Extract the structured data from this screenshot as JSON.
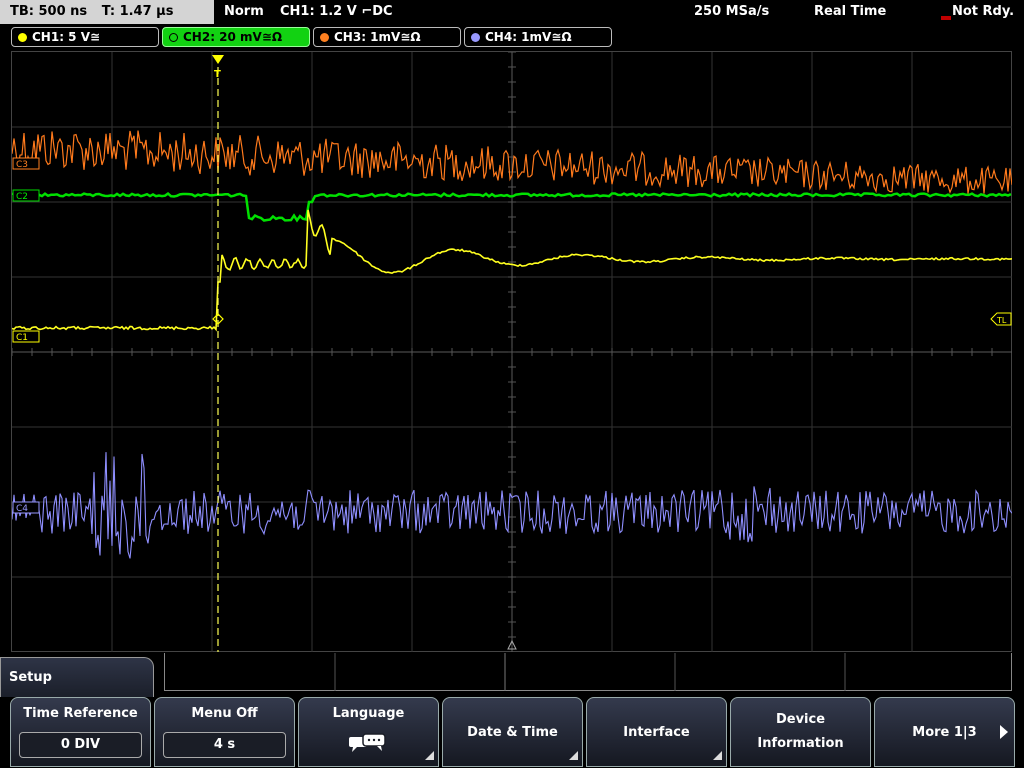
{
  "status": {
    "timebase": "TB: 500 ns",
    "trigger_time": "T: 1.47 µs",
    "mode": "Norm",
    "trigger_source": "CH1: 1.2 V ⌐DC",
    "sample_rate": "250 MSa/s",
    "acquisition": "Real Time",
    "state": "Not Rdy."
  },
  "channels": [
    {
      "label": "CH1: 5 V≅",
      "color": "#ffff00"
    },
    {
      "label": "CH2: 20 mV≅Ω",
      "color": "#00ff00"
    },
    {
      "label": "CH3: 1mV≅Ω",
      "color": "#ff8020"
    },
    {
      "label": "CH4: 1mV≅Ω",
      "color": "#9999ff"
    }
  ],
  "markers": {
    "c3": "C3",
    "c2": "C2",
    "c1": "C1",
    "c4": "C4",
    "trigger_level": "TL",
    "trigger_pos": "T"
  },
  "menu": {
    "title": "Setup",
    "keys": [
      {
        "label": "Time Reference",
        "value": "0 DIV"
      },
      {
        "label": "Menu Off",
        "value": "4 s"
      },
      {
        "label": "Language",
        "icon": "speech-bubble-icon"
      },
      {
        "label": "Date & Time"
      },
      {
        "label": "Interface"
      },
      {
        "label": "Device",
        "label2": "Information"
      },
      {
        "label": "More 1|3"
      }
    ]
  }
}
